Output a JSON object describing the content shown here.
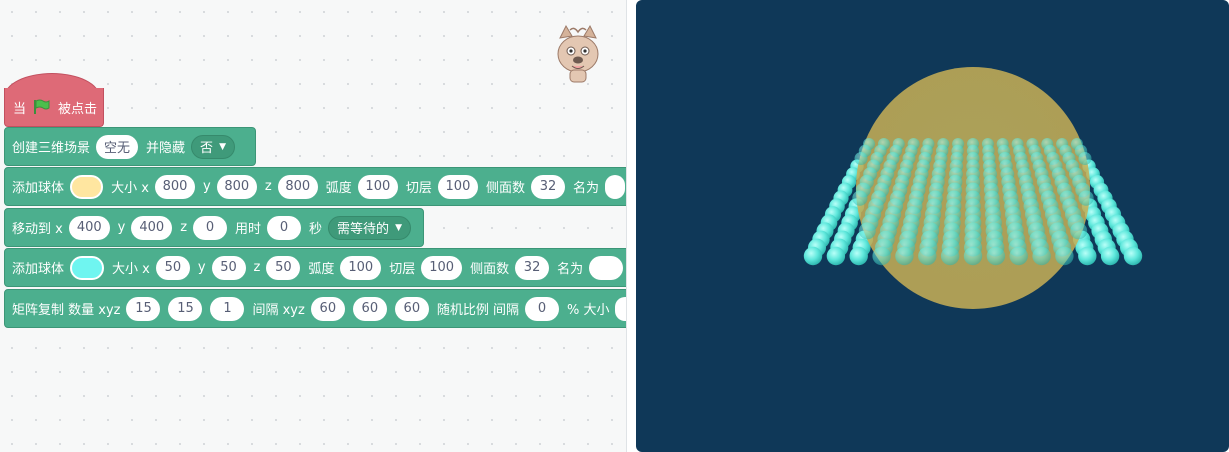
{
  "hat": {
    "when_label": "当",
    "flag_icon": "green-flag-icon",
    "clicked_label": "被点击"
  },
  "create_scene": {
    "label": "创建三维场景",
    "value": "空无",
    "hide_label": "并隐藏",
    "hide_value": "否"
  },
  "add_sphere_1": {
    "label": "添加球体",
    "color": "#ffe6a0",
    "size_label": "大小 x",
    "x": "800",
    "y_label": "y",
    "y": "800",
    "z_label": "z",
    "z": "800",
    "arc_label": "弧度",
    "arc": "100",
    "layers_label": "切层",
    "layers": "100",
    "sides_label": "侧面数",
    "sides": "32",
    "name_label": "名为"
  },
  "move_to": {
    "label": "移动到 x",
    "x": "400",
    "y_label": "y",
    "y": "400",
    "z_label": "z",
    "z": "0",
    "time_label": "用时",
    "time": "0",
    "sec_label": "秒",
    "wait_value": "需等待的"
  },
  "add_sphere_2": {
    "label": "添加球体",
    "color": "#6ff5f0",
    "size_label": "大小 x",
    "x": "50",
    "y_label": "y",
    "y": "50",
    "z_label": "z",
    "z": "50",
    "arc_label": "弧度",
    "arc": "100",
    "layers_label": "切层",
    "layers": "100",
    "sides_label": "侧面数",
    "sides": "32",
    "name_label": "名为"
  },
  "matrix_copy": {
    "label": "矩阵复制 数量 xyz",
    "qx": "15",
    "qy": "15",
    "qz": "1",
    "gap_label": "间隔 xyz",
    "gx": "60",
    "gy": "60",
    "gz": "60",
    "random_label": "随机比例 间隔",
    "random": "0",
    "pct_label": "% 大小"
  },
  "stage": {
    "background": "#0f3858",
    "big_sphere_color": "#d8c25a",
    "small_sphere_color": "#5ef0e6",
    "grid_count_x": 15,
    "grid_count_y": 15
  }
}
